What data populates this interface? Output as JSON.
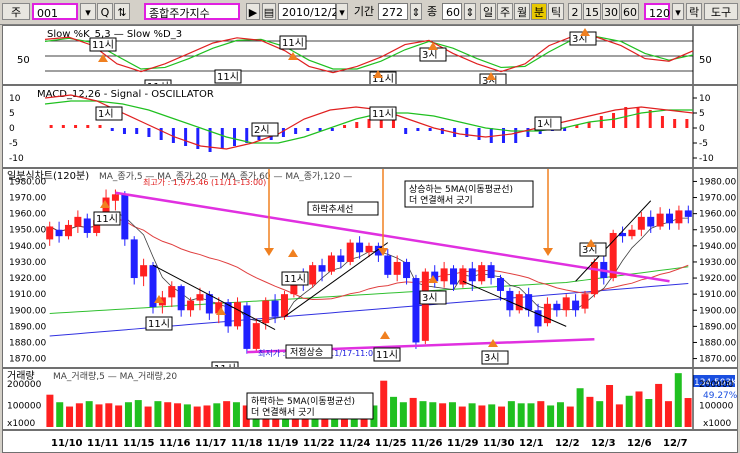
{
  "toolbar": {
    "jong_label": "주",
    "code": "001",
    "search_icon": "search-icon",
    "name": "종합주가지수",
    "date": "2010/12/22",
    "period_label": "기간",
    "period_value": "272",
    "count_value": "60",
    "btn_day": "일",
    "btn_week": "주",
    "btn_month": "월",
    "btn_min": "분",
    "btn_tick": "틱",
    "m2": "2",
    "m15": "15",
    "m30": "30",
    "m60": "60",
    "m120": "120",
    "btn_rak": "락",
    "btn_tools": "도구"
  },
  "stoch": {
    "title": "Slow %K_5,3 — Slow %D_3",
    "ticks": [
      "50"
    ]
  },
  "macd": {
    "title": "MACD_12,26 - Signal - OSCILLATOR",
    "ticks": [
      "10",
      "5",
      "0",
      "-5",
      "-10"
    ]
  },
  "price": {
    "title": "일분식차트(120분)",
    "legend": "MA_종가,5 — MA_종가,20 — MA_종가,60 — MA_종가,120 —",
    "high_label": "최고가 : 1,975.46 (11/11-13:00)",
    "low_label": "최저가 : 1,873.54 (11/17-11:00)",
    "ticks": [
      "1980.00",
      "1970.00",
      "1960.00",
      "1950.00",
      "1940.00",
      "1930.00",
      "1920.00",
      "1910.00",
      "1900.00",
      "1890.00",
      "1880.00",
      "1870.00"
    ]
  },
  "volume": {
    "title": "거래량",
    "legend": "MA_거래량,5 — MA_거래량,20",
    "ticks": [
      "200000",
      "100000"
    ],
    "last_value": "134,503K",
    "last_pct": "49.27%",
    "unit": "x1000"
  },
  "xaxis": [
    "11/10",
    "11/11",
    "11/15",
    "11/16",
    "11/17",
    "11/18",
    "11/19",
    "11/22",
    "11/24",
    "11/25",
    "11/26",
    "11/29",
    "11/30",
    "12/1",
    "12/2",
    "12/3",
    "12/6",
    "12/7"
  ],
  "annotations": {
    "a11": "11시",
    "a3": "3시",
    "a2": "2시",
    "a1": "1시",
    "downtrend": "하락추세선",
    "up_note_1": "상승하는 5MA(이동평균선)",
    "up_note_2": "더 연결해서 긋기",
    "down_note_1": "하락하는 5MA(이동평균선)",
    "down_note_2": "더 연결해서 긋기",
    "low_rise": "저점상승"
  },
  "colors": {
    "up": "#ff2020",
    "down": "#2020ff",
    "trend": "#e030e0",
    "arrow": "#f08020",
    "ma5": "#e03030",
    "ma20": "#20c020",
    "ma60": "#30c030",
    "ma120": "#3030e0"
  },
  "chart_data": [
    {
      "type": "line",
      "title": "Slow %K_5,3 / Slow %D_3",
      "ylim": [
        0,
        100
      ],
      "series": [
        {
          "name": "Slow %K_5,3",
          "values": [
            82,
            86,
            70,
            35,
            20,
            35,
            55,
            75,
            85,
            80,
            60,
            30,
            18,
            30,
            48,
            72,
            80,
            55,
            35,
            20,
            35,
            70,
            88,
            86,
            70,
            45,
            40,
            60
          ]
        },
        {
          "name": "Slow %D_3",
          "values": [
            78,
            84,
            76,
            50,
            25,
            28,
            45,
            65,
            80,
            82,
            68,
            42,
            25,
            25,
            40,
            62,
            78,
            65,
            45,
            28,
            30,
            58,
            82,
            87,
            78,
            55,
            42,
            52
          ]
        }
      ]
    },
    {
      "type": "bar",
      "title": "MACD_12,26 / Signal / OSCILLATOR",
      "ylim": [
        -12,
        12
      ],
      "series": [
        {
          "name": "MACD_12,26",
          "values": [
            10,
            11,
            9,
            5,
            1,
            -3,
            -6,
            -7,
            -5,
            -2,
            3,
            6,
            7,
            6,
            3,
            0,
            -2,
            -3,
            -2,
            0,
            2,
            4,
            6,
            7,
            6,
            5
          ]
        },
        {
          "name": "Signal",
          "values": [
            8,
            9,
            9,
            8,
            6,
            3,
            0,
            -3,
            -5,
            -5,
            -3,
            0,
            3,
            5,
            5,
            4,
            2,
            0,
            -1,
            -1,
            0,
            2,
            3,
            5,
            6,
            6
          ]
        },
        {
          "name": "OSCILLATOR",
          "values": [
            1,
            1,
            1,
            1,
            1,
            -1,
            -2,
            -2,
            -3,
            -4,
            -5,
            -6,
            -7,
            -8,
            -7,
            -6,
            -5,
            -4,
            -4,
            -3,
            -2,
            -1,
            -1,
            -1,
            1,
            2,
            3,
            4,
            3,
            -2,
            -1,
            -1,
            -2,
            -3,
            -3,
            -4,
            -5,
            -5,
            -5,
            -3,
            -2,
            -1,
            -1,
            1,
            2,
            4,
            5,
            7,
            7,
            6,
            4,
            3,
            3
          ]
        }
      ]
    },
    {
      "type": "candlestick",
      "title": "일분식차트(120분)",
      "ylim": [
        1866,
        1984
      ],
      "candles": [
        [
          1944,
          1952,
          1940,
          1955
        ],
        [
          1950,
          1946,
          1942,
          1955
        ],
        [
          1946,
          1953,
          1944,
          1956
        ],
        [
          1952,
          1958,
          1948,
          1962
        ],
        [
          1957,
          1948,
          1945,
          1960
        ],
        [
          1948,
          1956,
          1946,
          1960
        ],
        [
          1955,
          1970,
          1953,
          1975
        ],
        [
          1968,
          1972,
          1962,
          1975
        ],
        [
          1972,
          1944,
          1940,
          1974
        ],
        [
          1944,
          1920,
          1916,
          1946
        ],
        [
          1921,
          1928,
          1915,
          1932
        ],
        [
          1928,
          1902,
          1898,
          1930
        ],
        [
          1903,
          1908,
          1898,
          1912
        ],
        [
          1908,
          1915,
          1902,
          1918
        ],
        [
          1915,
          1900,
          1896,
          1916
        ],
        [
          1900,
          1906,
          1896,
          1908
        ],
        [
          1906,
          1910,
          1900,
          1914
        ],
        [
          1910,
          1898,
          1894,
          1912
        ],
        [
          1898,
          1905,
          1892,
          1908
        ],
        [
          1905,
          1890,
          1886,
          1907
        ],
        [
          1890,
          1905,
          1888,
          1908
        ],
        [
          1903,
          1876,
          1873,
          1905
        ],
        [
          1876,
          1892,
          1874,
          1895
        ],
        [
          1892,
          1906,
          1888,
          1908
        ],
        [
          1906,
          1896,
          1892,
          1910
        ],
        [
          1896,
          1910,
          1894,
          1912
        ],
        [
          1910,
          1922,
          1908,
          1924
        ],
        [
          1922,
          1916,
          1912,
          1926
        ],
        [
          1916,
          1928,
          1914,
          1930
        ],
        [
          1928,
          1924,
          1918,
          1932
        ],
        [
          1924,
          1934,
          1922,
          1936
        ],
        [
          1934,
          1930,
          1926,
          1938
        ],
        [
          1930,
          1942,
          1928,
          1944
        ],
        [
          1942,
          1936,
          1932,
          1946
        ],
        [
          1936,
          1940,
          1933,
          1942
        ],
        [
          1940,
          1934,
          1930,
          1942
        ],
        [
          1934,
          1922,
          1920,
          1938
        ],
        [
          1922,
          1930,
          1918,
          1934
        ],
        [
          1930,
          1920,
          1916,
          1932
        ],
        [
          1920,
          1880,
          1876,
          1922
        ],
        [
          1881,
          1924,
          1879,
          1926
        ],
        [
          1924,
          1918,
          1914,
          1928
        ],
        [
          1918,
          1926,
          1914,
          1930
        ],
        [
          1926,
          1916,
          1912,
          1928
        ],
        [
          1916,
          1926,
          1914,
          1928
        ],
        [
          1926,
          1918,
          1912,
          1930
        ],
        [
          1918,
          1928,
          1916,
          1930
        ],
        [
          1928,
          1920,
          1916,
          1930
        ],
        [
          1920,
          1912,
          1906,
          1922
        ],
        [
          1912,
          1900,
          1896,
          1914
        ],
        [
          1900,
          1910,
          1898,
          1912
        ],
        [
          1910,
          1900,
          1896,
          1914
        ],
        [
          1900,
          1890,
          1886,
          1904
        ],
        [
          1892,
          1904,
          1890,
          1908
        ],
        [
          1904,
          1900,
          1896,
          1906
        ],
        [
          1900,
          1908,
          1896,
          1910
        ],
        [
          1906,
          1900,
          1896,
          1910
        ],
        [
          1901,
          1910,
          1898,
          1912
        ],
        [
          1910,
          1930,
          1908,
          1932
        ],
        [
          1930,
          1920,
          1916,
          1934
        ],
        [
          1920,
          1948,
          1918,
          1950
        ],
        [
          1948,
          1946,
          1942,
          1952
        ],
        [
          1946,
          1950,
          1944,
          1953
        ],
        [
          1950,
          1958,
          1946,
          1961
        ],
        [
          1958,
          1952,
          1948,
          1962
        ],
        [
          1952,
          1960,
          1950,
          1964
        ],
        [
          1960,
          1954,
          1950,
          1963
        ],
        [
          1954,
          1962,
          1950,
          1965
        ],
        [
          1962,
          1958,
          1954,
          1965
        ]
      ]
    },
    {
      "type": "bar",
      "title": "거래량",
      "ylim": [
        0,
        260000
      ],
      "values": [
        150000,
        115000,
        95000,
        110000,
        120000,
        105000,
        110000,
        100000,
        115000,
        125000,
        95000,
        120000,
        115000,
        110000,
        105000,
        95000,
        100000,
        110000,
        120000,
        115000,
        100000,
        130000,
        110000,
        115000,
        125000,
        120000,
        100000,
        115000,
        105000,
        125000,
        130000,
        110000,
        120000,
        100000,
        215000,
        140000,
        115000,
        135000,
        120000,
        115000,
        110000,
        115000,
        95000,
        110000,
        100000,
        105000,
        95000,
        120000,
        110000,
        110000,
        120000,
        100000,
        115000,
        95000,
        180000,
        140000,
        120000,
        195000,
        105000,
        145000,
        165000,
        130000,
        200000,
        120000,
        250000,
        134503
      ]
    }
  ]
}
